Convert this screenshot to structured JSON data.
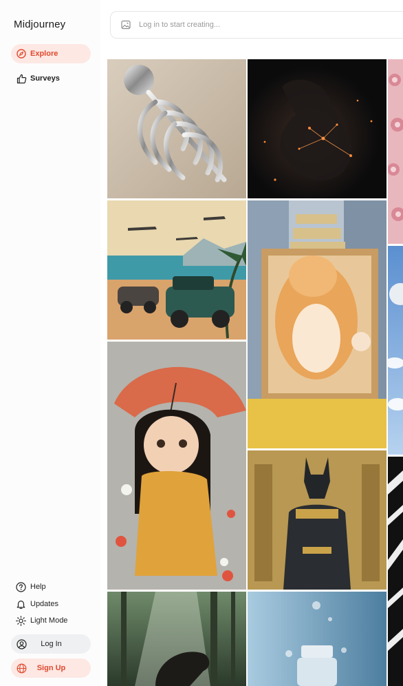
{
  "app": {
    "title": "Midjourney"
  },
  "nav": {
    "explore": {
      "label": "Explore",
      "icon": "compass-icon",
      "active": true
    },
    "surveys": {
      "label": "Surveys",
      "icon": "thumbs-up-icon"
    }
  },
  "search": {
    "placeholder": "Log in to start creating...",
    "value": "",
    "icon": "image-icon"
  },
  "footer": {
    "help": {
      "label": "Help",
      "icon": "help-icon"
    },
    "updates": {
      "label": "Updates",
      "icon": "bell-icon"
    },
    "light_mode": {
      "label": "Light Mode",
      "icon": "sun-icon"
    },
    "login": {
      "label": "Log In",
      "icon": "user-circle-icon"
    },
    "signup": {
      "label": "Sign Up",
      "icon": "globe-icon"
    }
  },
  "colors": {
    "accent": "#e0492f",
    "accent_bg": "#fde8e3",
    "pill_bg": "#eff0f2"
  },
  "gallery": [
    {
      "name": "chrome-skeleton"
    },
    {
      "name": "glowing-hand"
    },
    {
      "name": "pink-roses"
    },
    {
      "name": "vintage-beach-car"
    },
    {
      "name": "cat-in-box"
    },
    {
      "name": "moon-sky"
    },
    {
      "name": "girl-with-umbrella"
    },
    {
      "name": "anubis-statue"
    },
    {
      "name": "zebra-pattern"
    },
    {
      "name": "forest-horse"
    },
    {
      "name": "bottle-water"
    }
  ]
}
